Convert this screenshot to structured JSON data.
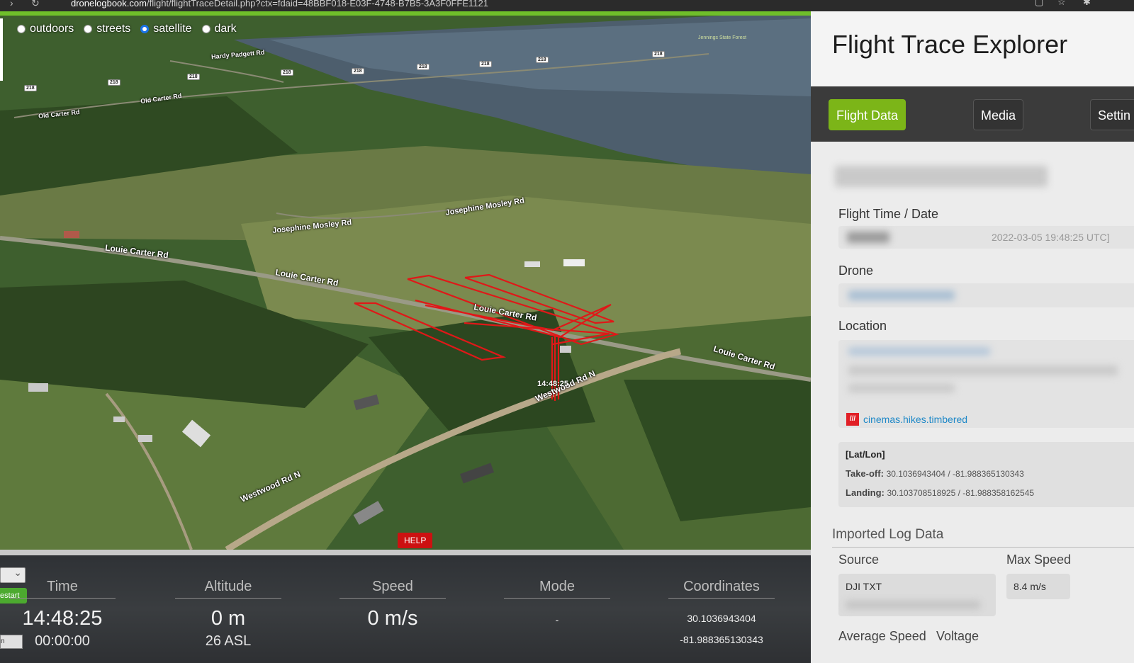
{
  "browser": {
    "url_host": "dronelogbook.com",
    "url_path": "/flight/flightTraceDetail.php?ctx=fdaid=48BBF018-E03F-4748-B7B5-3A3F0FFE1121"
  },
  "map": {
    "style_options": [
      {
        "label": "outdoors",
        "selected": false
      },
      {
        "label": "streets",
        "selected": false
      },
      {
        "label": "satellite",
        "selected": true
      },
      {
        "label": "dark",
        "selected": false
      }
    ],
    "road_labels": {
      "hardy_padgett": "Hardy Padgett Rd",
      "old_carter_1": "Old Carter Rd",
      "old_carter_2": "Old Carter Rd",
      "josephine_1": "Josephine Mosley Rd",
      "josephine_2": "Josephine Mosley Rd",
      "louie_1": "Louie Carter Rd",
      "louie_2": "Louie Carter Rd",
      "louie_3": "Louie Carter Rd",
      "louie_4": "Louie Carter Rd",
      "westwood_1": "Westwood Rd N",
      "westwood_2": "Westwood Rd N",
      "forest": "Jennings State Forest"
    },
    "route_shield": "218",
    "current_time_label": "14:48:25",
    "help_label": "HELP",
    "progress_color": "#6fbf2a",
    "track_color": "#e01818"
  },
  "telemetry": {
    "restart_label": "estart",
    "speed_field": "n",
    "columns": [
      {
        "head": "Time",
        "value": "14:48:25",
        "sub": "00:00:00"
      },
      {
        "head": "Altitude",
        "value": "0 m",
        "sub": "26 ASL"
      },
      {
        "head": "Speed",
        "value": "0 m/s",
        "sub": ""
      },
      {
        "head": "Mode",
        "value": "-",
        "sub": ""
      },
      {
        "head": "Coordinates",
        "value": "30.1036943404",
        "sub": "-81.988365130343"
      }
    ]
  },
  "panel": {
    "title": "Flight Trace Explorer",
    "tabs": [
      {
        "label": "Flight Data",
        "active": true
      },
      {
        "label": "Media",
        "active": false
      },
      {
        "label": "Settin",
        "active": false
      }
    ],
    "flight_time_label": "Flight Time / Date",
    "flight_time_value": "2022-03-05 19:48:25 UTC]",
    "drone_label": "Drone",
    "location_label": "Location",
    "w3w_icon": "///",
    "w3w_link": "cinemas.hikes.timbered",
    "latlon": {
      "title": "[Lat/Lon]",
      "takeoff_label": "Take-off:",
      "takeoff_value": "30.1036943404 / -81.988365130343",
      "landing_label": "Landing:",
      "landing_value": "30.103708518925 / -81.988358162545"
    },
    "imported_title": "Imported Log Data",
    "source_label": "Source",
    "source_value": "DJI TXT",
    "max_speed_label": "Max Speed",
    "max_speed_value": "8.4 m/s",
    "avg_speed_label": "Average Speed",
    "voltage_label": "Voltage",
    "accent_color": "#7cb518"
  }
}
